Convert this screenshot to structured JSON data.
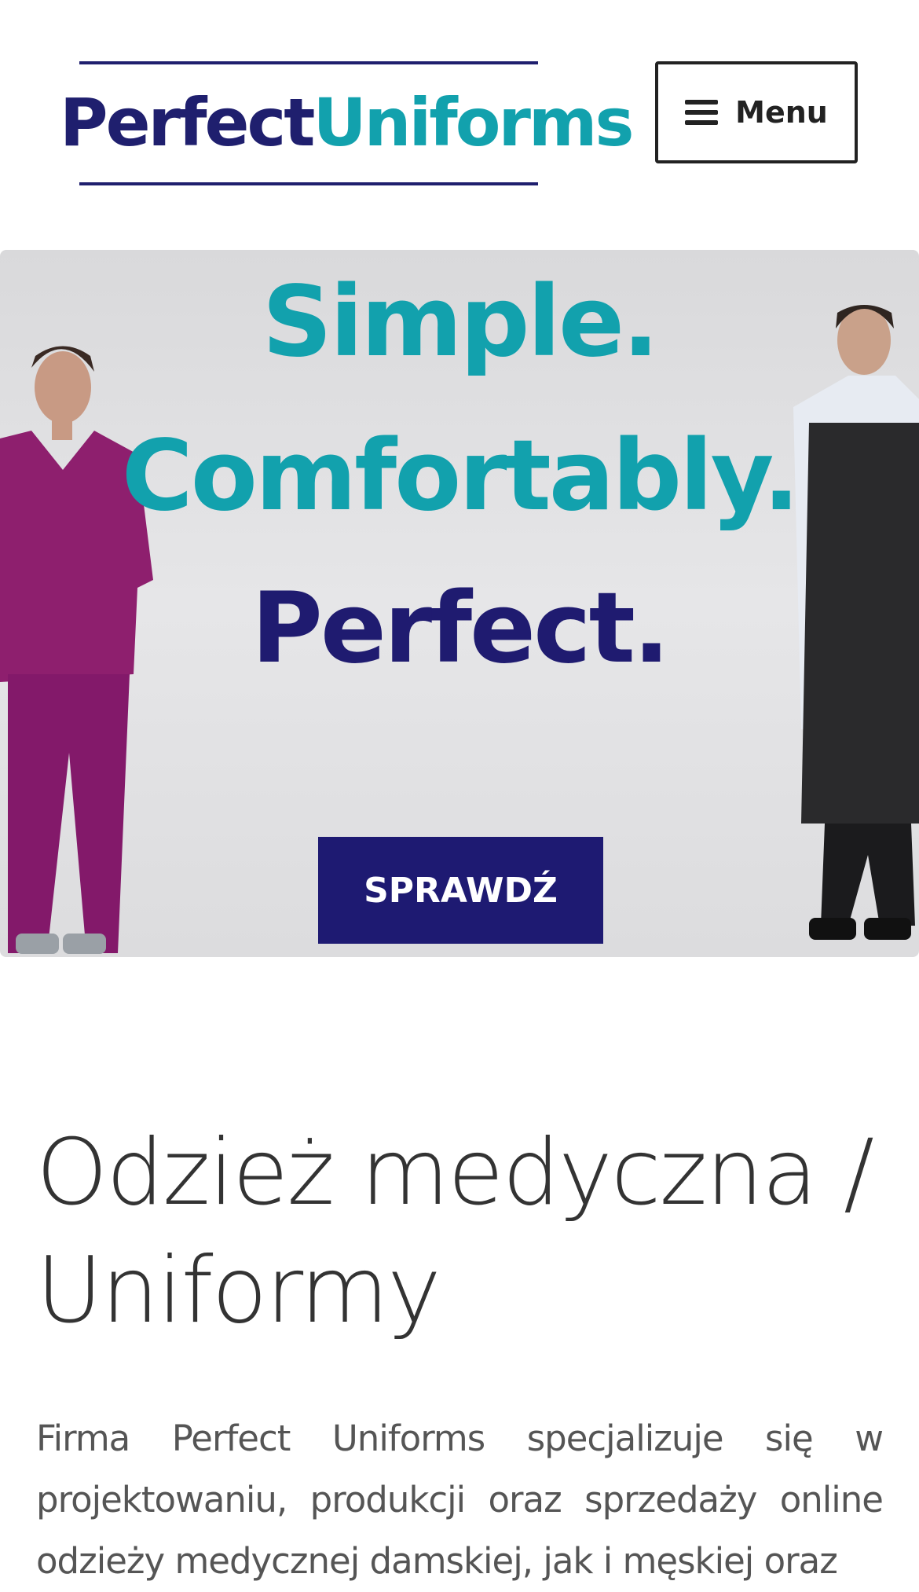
{
  "header": {
    "logo": {
      "part1": "Perfect",
      "part2": "Uniforms"
    },
    "menu_label": "Menu",
    "menu_icon": "hamburger-icon"
  },
  "hero": {
    "line1": "Simple.",
    "line2": "Comfortably.",
    "line3": "Perfect.",
    "cta_label": "SPRAWDŹ"
  },
  "content": {
    "heading": "Odzież medyczna / Uniformy",
    "paragraph": "Firma Perfect Uniforms specjalizuje się w projektowaniu, produkcji oraz sprzedaży online odzieży medycznej damskiej, jak i męskiej oraz"
  },
  "colors": {
    "navy": "#1e1a72",
    "teal": "#12a1ad",
    "scrubs_magenta": "#8e1f6e",
    "apron_black": "#2a2a2c"
  }
}
